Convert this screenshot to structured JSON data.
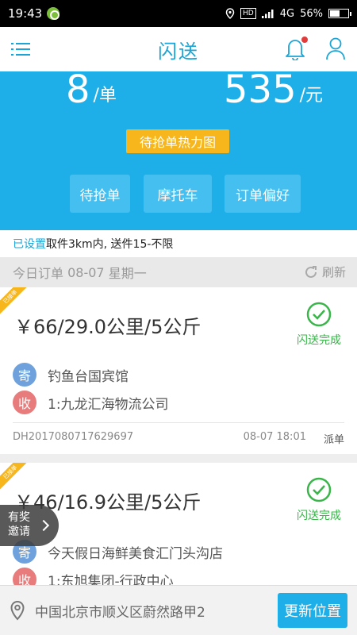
{
  "status_bar": {
    "time": "19:43",
    "network": "4G",
    "battery": "56%",
    "hd_label": "HD"
  },
  "nav": {
    "title": "闪送"
  },
  "stats": {
    "orders": {
      "value": "8",
      "unit": "/单"
    },
    "income": {
      "value": "535",
      "unit": "/元"
    }
  },
  "heatmap_button": "待抢单热力图",
  "quick_buttons": [
    "待抢单",
    "摩托车",
    "订单偏好"
  ],
  "preference": {
    "set_label": "已设置",
    "text": "取件3km内, 送件15-不限"
  },
  "date_bar": {
    "label": "今日订单",
    "date": "08-07",
    "weekday": "星期一",
    "refresh": "刷新"
  },
  "orders": [
    {
      "ribbon": "已接单",
      "price": "￥66/29.0公里/5公斤",
      "status": "闪送完成",
      "sender_tag": "寄",
      "sender": "钓鱼台国宾馆",
      "receiver_tag": "收",
      "receiver": "1:九龙汇海物流公司",
      "order_no": "DH2017080717629697",
      "time": "08-07 18:01",
      "action": "派单"
    },
    {
      "ribbon": "已接单",
      "price": "￥46/16.9公里/5公斤",
      "status": "闪送完成",
      "sender_tag": "寄",
      "sender": "今天假日海鲜美食汇门头沟店",
      "receiver_tag": "收",
      "receiver": "1:东旭集团-行政中心"
    }
  ],
  "invite": {
    "line1": "有奖",
    "line2": "邀请"
  },
  "location": {
    "address": "中国北京市顺义区蔚然路甲2",
    "update_button": "更新位置"
  },
  "colors": {
    "brand": "#1eaee8",
    "accent": "#f7b61c",
    "success": "#39b54a"
  }
}
